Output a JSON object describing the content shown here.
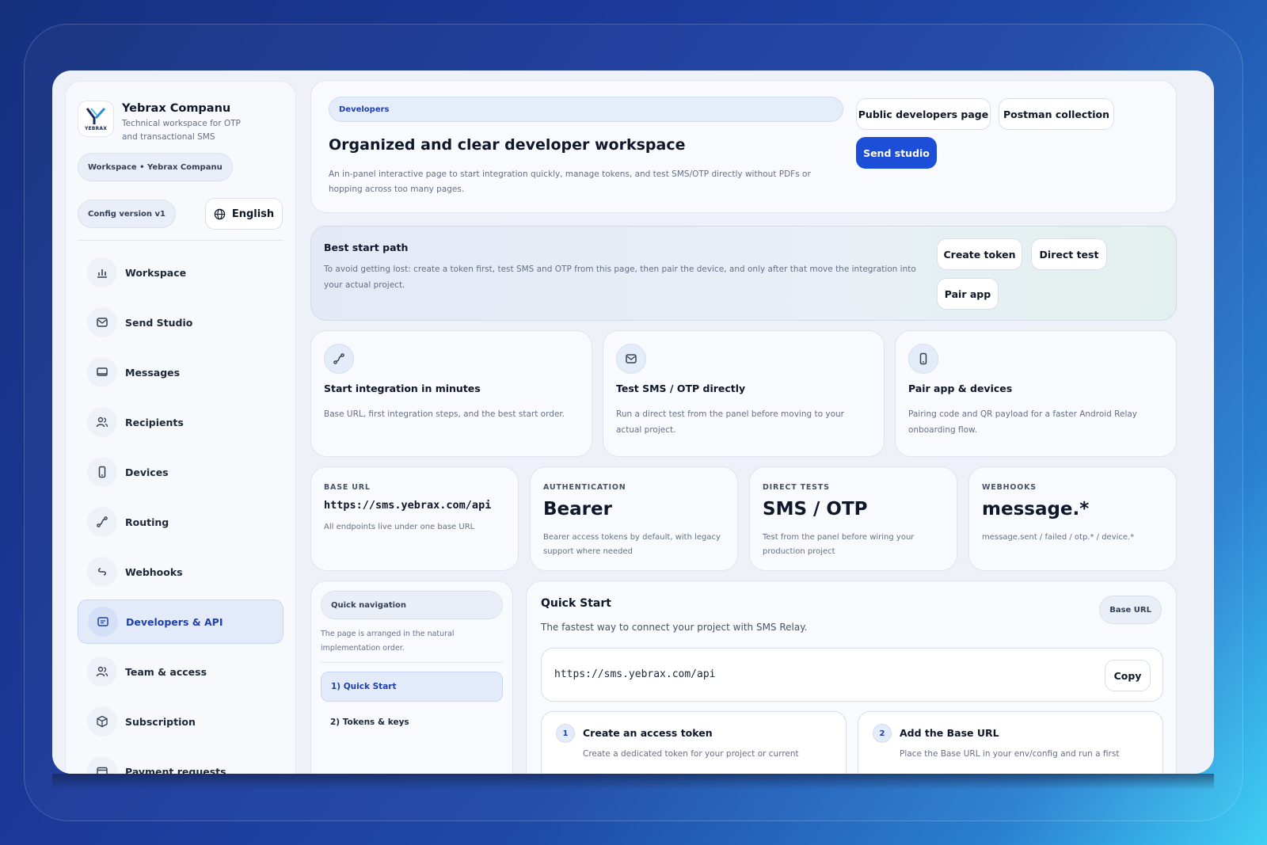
{
  "sidebar": {
    "brand_name": "Yebrax Companu",
    "brand_sub": "Technical workspace for OTP and transactional SMS",
    "logo_text": "YEBRAX",
    "workspace_pill": "Workspace • Yebrax Companu",
    "config_pill": "Config version v1",
    "language": "English",
    "items": [
      {
        "label": "Workspace",
        "icon": "bar-chart-icon"
      },
      {
        "label": "Send Studio",
        "icon": "mail-icon"
      },
      {
        "label": "Messages",
        "icon": "inbox-icon"
      },
      {
        "label": "Recipients",
        "icon": "users-icon"
      },
      {
        "label": "Devices",
        "icon": "phone-icon"
      },
      {
        "label": "Routing",
        "icon": "route-icon"
      },
      {
        "label": "Webhooks",
        "icon": "webhook-icon"
      },
      {
        "label": "Developers & API",
        "icon": "api-icon",
        "active": true
      },
      {
        "label": "Team & access",
        "icon": "team-icon"
      },
      {
        "label": "Subscription",
        "icon": "box-icon"
      },
      {
        "label": "Payment requests",
        "icon": "card-icon"
      }
    ]
  },
  "header": {
    "section": "Developers",
    "title": "Organized and clear developer workspace",
    "description": "An in-panel interactive page to start integration quickly, manage tokens, and test SMS/OTP directly without PDFs or hopping across too many pages.",
    "btn_public": "Public developers page",
    "btn_postman": "Postman collection",
    "btn_studio": "Send studio"
  },
  "start_path": {
    "title": "Best start path",
    "description": "To avoid getting lost: create a token first, test SMS and OTP from this page, then pair the device, and only after that move the integration into your actual project.",
    "btn_token": "Create token",
    "btn_direct": "Direct test",
    "btn_pair": "Pair app"
  },
  "features": [
    {
      "title": "Start integration in minutes",
      "desc": "Base URL, first integration steps, and the best start order.",
      "icon": "route-icon"
    },
    {
      "title": "Test SMS / OTP directly",
      "desc": "Run a direct test from the panel before moving to your actual project.",
      "icon": "mail-icon"
    },
    {
      "title": "Pair app & devices",
      "desc": "Pairing code and QR payload for a faster Android Relay onboarding flow.",
      "icon": "phone-icon"
    }
  ],
  "stats": [
    {
      "label": "BASE URL",
      "value": "https://sms.yebrax.com/api",
      "desc": "All endpoints live under one base URL"
    },
    {
      "label": "AUTHENTICATION",
      "value": "Bearer",
      "desc": "Bearer access tokens by default, with legacy support where needed"
    },
    {
      "label": "DIRECT TESTS",
      "value": "SMS / OTP",
      "desc": "Test from the panel before wiring your production project"
    },
    {
      "label": "WEBHOOKS",
      "value": "message.*",
      "desc": "message.sent / failed / otp.* / device.*"
    }
  ],
  "quick_nav": {
    "title": "Quick navigation",
    "desc": "The page is arranged in the natural implementation order.",
    "items": [
      "1) Quick Start",
      "2) Tokens & keys"
    ]
  },
  "quick_start": {
    "title": "Quick Start",
    "subtitle": "The fastest way to connect your project with SMS Relay.",
    "badge": "Base URL",
    "url": "https://sms.yebrax.com/api",
    "copy": "Copy",
    "steps": [
      {
        "num": "1",
        "title": "Create an access token",
        "desc": "Create a dedicated token for your project or current"
      },
      {
        "num": "2",
        "title": "Add the Base URL",
        "desc": "Place the Base URL in your env/config and run a first"
      }
    ]
  },
  "colors": {
    "accent": "#1d4ed8",
    "active_bg": "#e3ebfb"
  }
}
